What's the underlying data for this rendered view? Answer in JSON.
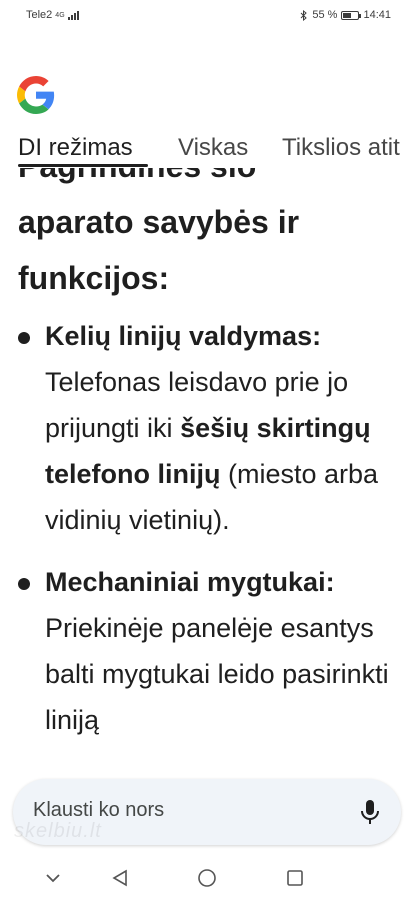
{
  "status_bar": {
    "carrier": "Tele2",
    "network_tag": "4G",
    "battery_percent": "55 %",
    "battery_level": 0.55,
    "time": "14:41"
  },
  "logo": {
    "name": "Google",
    "colors": [
      "#4285F4",
      "#EA4335",
      "#FBBC05",
      "#34A853"
    ]
  },
  "tabs": [
    {
      "label": "DI režimas",
      "active": true
    },
    {
      "label": "Viskas",
      "active": false
    },
    {
      "label": "Tikslios atit",
      "active": false
    }
  ],
  "content": {
    "heading_line_partial": "Pagrindinės šio",
    "heading_line_2": "aparato savybės ir",
    "heading_line_3": "funkcijos:",
    "bullets": [
      {
        "title": "Kelių linijų valdymas:",
        "text_1": "Telefonas leisdavo prie jo prijungti iki",
        "emph": "šešių skirtingų telefono linijų",
        "text_2": "(miesto arba vidinių vietinių)."
      },
      {
        "title": "Mechaniniai mygtukai:",
        "text_1": "Priekinėje panelėje esantys balti mygtukai",
        "text_cut": "leido pasirinkti liniją"
      }
    ]
  },
  "ask_bar": {
    "placeholder": "Klausti ko nors",
    "watermark": "skelbiu.lt"
  },
  "navigation": {
    "icons": [
      "chevron-down-icon",
      "back-icon",
      "home-icon",
      "recents-icon"
    ]
  }
}
